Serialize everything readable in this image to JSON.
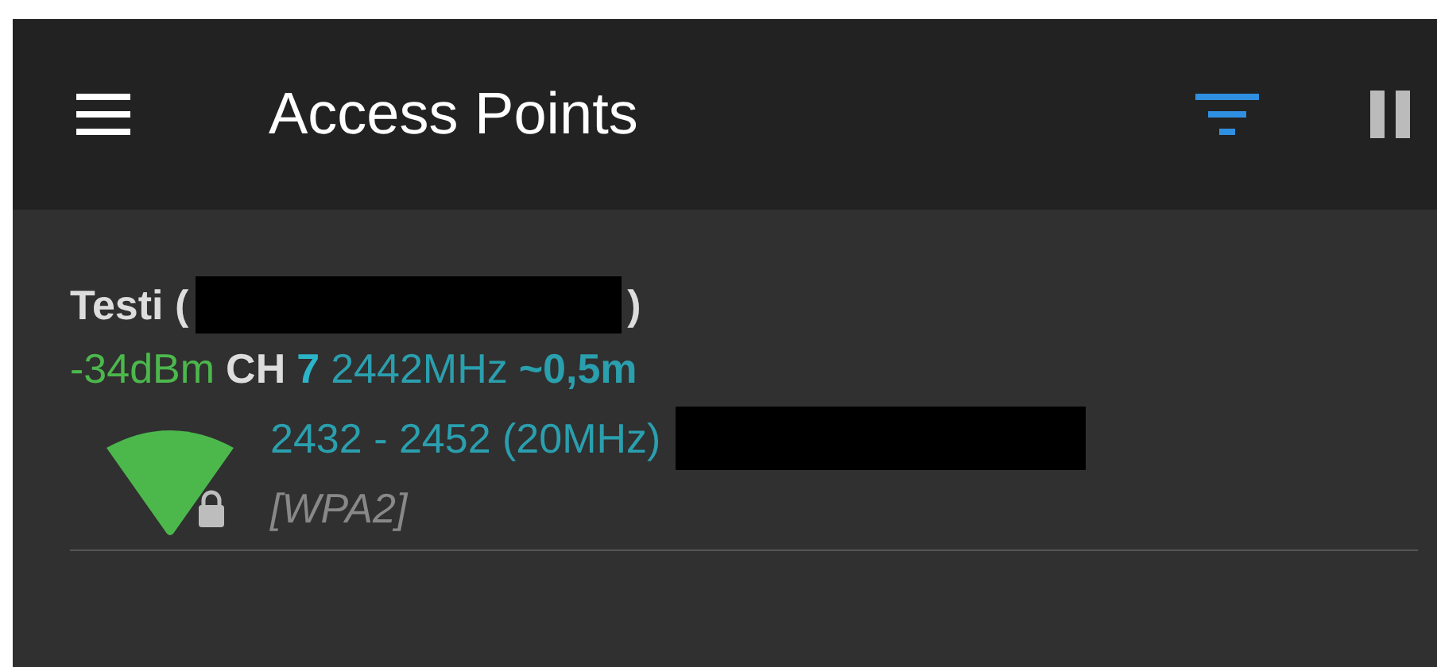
{
  "app_bar": {
    "title": "Access Points"
  },
  "access_points": [
    {
      "name_prefix": "Testi (",
      "name_redacted": true,
      "name_suffix": ")",
      "signal": "-34dBm",
      "channel_label": "CH",
      "channel": "7",
      "frequency": "2442MHz",
      "distance": "~0,5m",
      "range": "2432 - 2452 (20MHz)",
      "vendor_redacted": true,
      "secured": true,
      "security": "[WPA2]"
    }
  ]
}
